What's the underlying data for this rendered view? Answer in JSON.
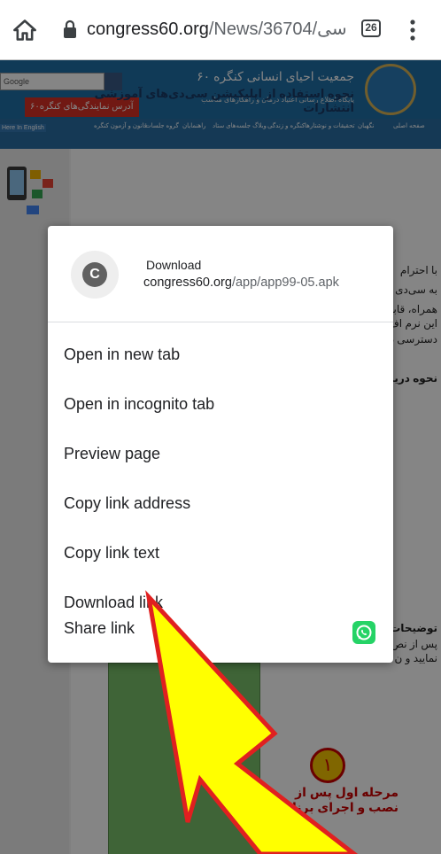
{
  "browser": {
    "url_host": "congress60.org",
    "url_path": "/News/36704/سی",
    "tab_count": "26",
    "icons": {
      "home": "home-icon",
      "lock": "lock-icon",
      "menu": "more-vert-icon"
    }
  },
  "page": {
    "search_placeholder": "Google",
    "rep_address": "آدرس نمایندگی‌های کنگره۶۰",
    "site_name": "جمعیت احیای انسانی کنگره ۶۰",
    "site_sub": "پایگاه اطلاع رسانی اعتیاد درمان و راهکارهای مناسب",
    "in_english": "Here In English",
    "nav": [
      "صفحه اصلی",
      "نگهبان",
      "تحقیقات و نوشتارها",
      "کنگره و زندگی",
      "وبلاگ جلسه‌های ستاد",
      "راهنمایان",
      "گروه جلسات",
      "قانون و آزمون کنگره"
    ],
    "article_title": "نحوه استفاده از اپلیکیشن سی‌دی‌های آموزشی انتشارات",
    "line1": "با احترام",
    "line2": "به سی‌دی",
    "line3": "همراه، قابل",
    "line4": "این نرم اف",
    "line5": "دسترسی د",
    "line6": "نحوه دریا",
    "line7": "توضیحات",
    "line8": "پس از نص",
    "line9": "نمایید و ن",
    "step_number": "۱",
    "step_text_1": "مرحله اول پس از",
    "step_text_2": "نصب و اجرای برنا"
  },
  "context_menu": {
    "header_title": "Download",
    "header_url_host": "congress60.org",
    "header_url_path": "/app/app99-05.apk",
    "favicon_letter": "C",
    "items": [
      {
        "label": "Open in new tab"
      },
      {
        "label": "Open in incognito tab"
      },
      {
        "label": "Preview page"
      },
      {
        "label": "Copy link address"
      },
      {
        "label": "Copy link text"
      },
      {
        "label": "Download link"
      },
      {
        "label": "Share link",
        "icon": "whatsapp-icon"
      }
    ]
  },
  "colors": {
    "arrow_fill": "#ffff00",
    "arrow_stroke": "#e02020",
    "whatsapp": "#25d366",
    "site_blue": "#1f6fa8"
  }
}
